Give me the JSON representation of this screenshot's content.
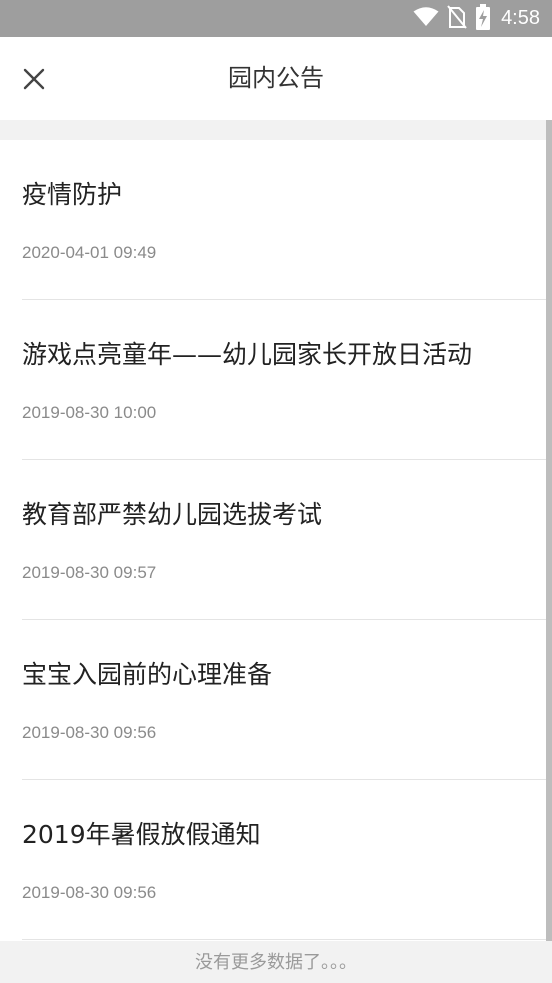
{
  "status_bar": {
    "time": "4:58",
    "icons": [
      "wifi-icon",
      "no-sim-icon",
      "battery-charging-icon"
    ],
    "background": "#9e9e9e"
  },
  "header": {
    "title": "园内公告",
    "close_icon": "close-icon"
  },
  "announcements": [
    {
      "title": "疫情防护",
      "date": "2020-04-01 09:49"
    },
    {
      "title": "游戏点亮童年——幼儿园家长开放日活动",
      "date": "2019-08-30 10:00"
    },
    {
      "title": "教育部严禁幼儿园选拔考试",
      "date": "2019-08-30 09:57"
    },
    {
      "title": "宝宝入园前的心理准备",
      "date": "2019-08-30 09:56"
    },
    {
      "title": "2019年暑假放假通知",
      "date": "2019-08-30 09:56"
    }
  ],
  "footer": {
    "text": "没有更多数据了。。。"
  }
}
